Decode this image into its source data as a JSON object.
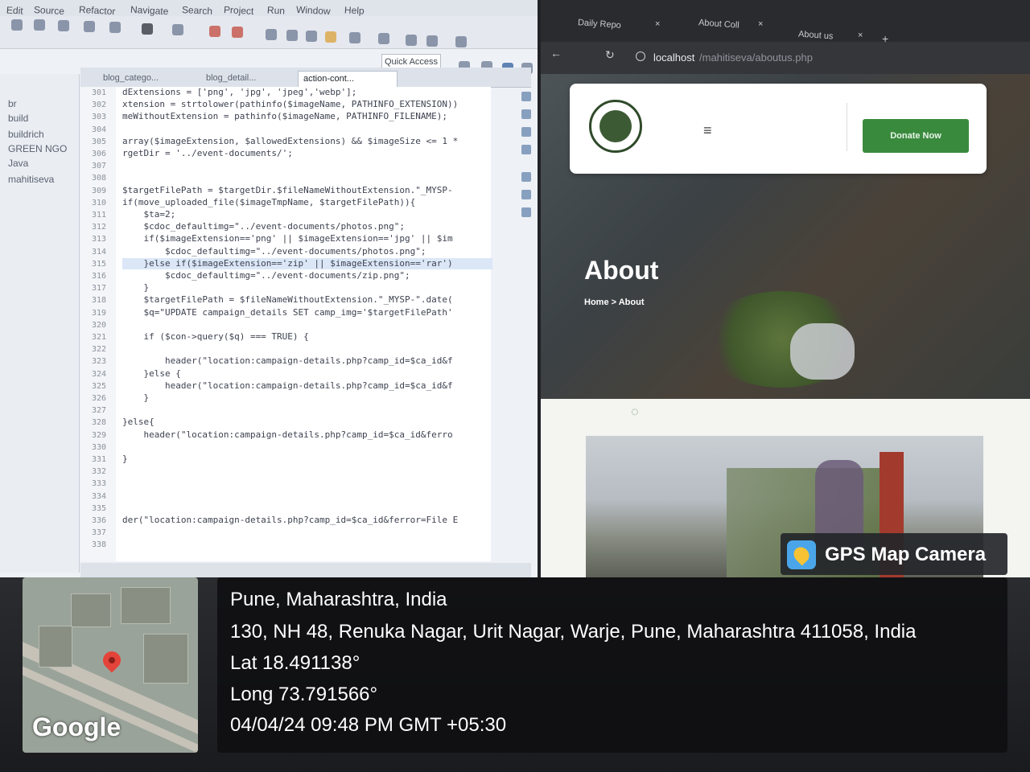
{
  "ide": {
    "menus": [
      "Edit",
      "Source",
      "Refactor",
      "Navigate",
      "Search",
      "Project",
      "Run",
      "Window",
      "Help"
    ],
    "quick_access": "Quick Access",
    "tabs": [
      "blog_catego...",
      "blog_detail...",
      "action-cont..."
    ],
    "tree": [
      "br",
      "build",
      "buildrich",
      "GREEN NGO",
      "Java",
      "mahitiseva"
    ],
    "line_numbers": [
      "301",
      "302",
      "303",
      "304",
      "305",
      "306",
      "307",
      "308",
      "309",
      "310",
      "311",
      "312",
      "313",
      "314",
      "315",
      "316",
      "317",
      "318",
      "319",
      "320",
      "321",
      "322",
      "323",
      "324",
      "325",
      "326",
      "327",
      "328",
      "329",
      "330",
      "331",
      "332",
      "333",
      "334",
      "335",
      "336",
      "337",
      "338"
    ],
    "code_lines": [
      "dExtensions = ['png', 'jpg', 'jpeg','webp'];",
      "xtension = strtolower(pathinfo($imageName, PATHINFO_EXTENSION))",
      "meWithoutExtension = pathinfo($imageName, PATHINFO_FILENAME);",
      "",
      "array($imageExtension, $allowedExtensions) && $imageSize <= 1 *",
      "rgetDir = '../event-documents/';",
      "",
      "",
      "$targetFilePath = $targetDir.$fileNameWithoutExtension.\"_MYSP-",
      "if(move_uploaded_file($imageTmpName, $targetFilePath)){",
      "    $ta=2;",
      "    $cdoc_defaultimg=\"../event-documents/photos.png\";",
      "    if($imageExtension=='png' || $imageExtension=='jpg' || $im",
      "        $cdoc_defaultimg=\"../event-documents/photos.png\";",
      "    }else if($imageExtension=='zip' || $imageExtension=='rar')",
      "        $cdoc_defaultimg=\"../event-documents/zip.png\";",
      "    }",
      "    $targetFilePath = $fileNameWithoutExtension.\"_MYSP-\".date(",
      "    $q=\"UPDATE campaign_details SET camp_img='$targetFilePath'",
      "",
      "    if ($con->query($q) === TRUE) {",
      "",
      "        header(\"location:campaign-details.php?camp_id=$ca_id&f",
      "    }else {",
      "        header(\"location:campaign-details.php?camp_id=$ca_id&f",
      "    }",
      "",
      "}else{",
      "    header(\"location:campaign-details.php?camp_id=$ca_id&ferro",
      "",
      "}",
      "",
      "",
      "",
      "",
      "der(\"location:campaign-details.php?camp_id=$ca_id&ferror=File E",
      ""
    ]
  },
  "browser": {
    "tabs": [
      "Daily Repo",
      "About Coll",
      "About us"
    ],
    "address": "localhost",
    "address_path": "/mahitiseva/aboutus.php",
    "donate_label": "Donate Now",
    "hero_title": "About",
    "breadcrumb_home": "Home",
    "breadcrumb_sep": ">",
    "breadcrumb_current": "About",
    "menu_glyph": "≡"
  },
  "gps": {
    "app_name": "GPS Map Camera",
    "map_brand": "Google",
    "city_line": "Pune, Maharashtra, India",
    "address_line": "130, NH 48, Renuka Nagar, Urit Nagar, Warje, Pune, Maharashtra 411058, India",
    "lat_line": "Lat 18.491138°",
    "long_line": "Long 73.791566°",
    "datetime_line": "04/04/24 09:48 PM GMT +05:30"
  },
  "icons": {
    "map_pin": "location-pin-icon",
    "app_logo": "gps-camera-icon",
    "menu": "hamburger-menu-icon"
  },
  "colors": {
    "donate_green": "#3a8a3e",
    "pin_red": "#e4433a",
    "ide_background": "#eef1f6"
  }
}
